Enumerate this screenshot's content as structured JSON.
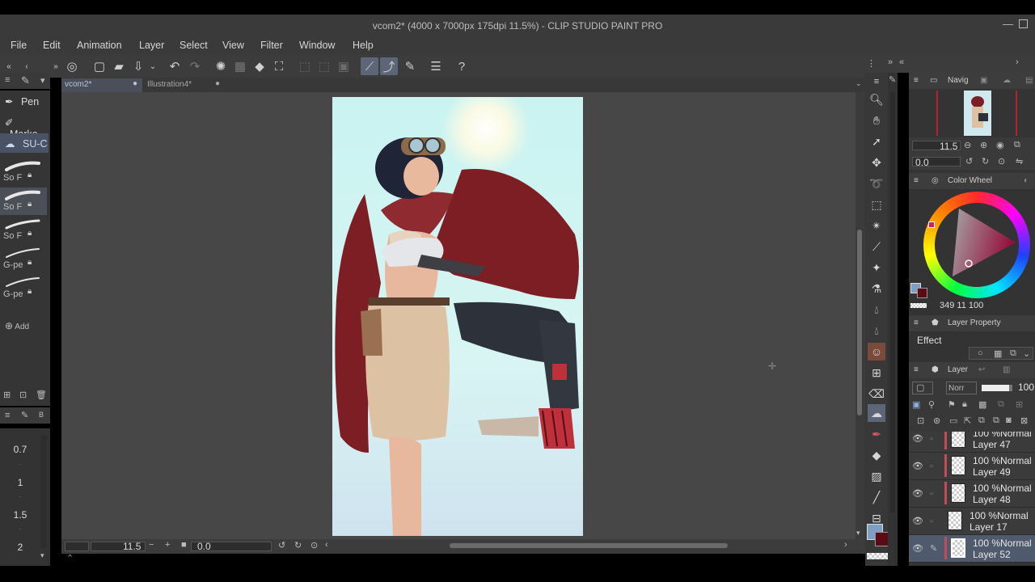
{
  "window": {
    "title": "vcom2* (4000 x 7000px 175dpi 11.5%)  - CLIP STUDIO PAINT PRO"
  },
  "menu": [
    "File",
    "Edit",
    "Animation",
    "Layer",
    "Select",
    "View",
    "Filter",
    "Window",
    "Help"
  ],
  "tabs": [
    {
      "label": "vcom2*",
      "active": true
    },
    {
      "label": "Illustration4*",
      "active": false
    }
  ],
  "subtools": [
    {
      "label": "Pen",
      "selected": false
    },
    {
      "label": "Marke",
      "selected": false
    },
    {
      "label": "SU-C",
      "selected": true
    }
  ],
  "brushes": [
    {
      "label": "So F",
      "selected": false
    },
    {
      "label": "So F",
      "selected": true
    },
    {
      "label": "So F",
      "selected": false
    },
    {
      "label": "G-pe",
      "selected": false
    },
    {
      "label": "G-pe",
      "selected": false
    }
  ],
  "add_label": "Add",
  "brush_size_header": "B",
  "brush_sizes": [
    "0.7",
    "1",
    "1.5",
    "2"
  ],
  "navigator": {
    "tab_label": "Navig",
    "zoom": "11.5",
    "rotation": "0.0"
  },
  "canvas_nav": {
    "zoom": "11.5",
    "rotation": "0.0"
  },
  "color_wheel": {
    "title": "Color Wheel",
    "values": "349 11 100",
    "main_color": "#7e9ec4",
    "sub_color": "#5a0c16"
  },
  "layer_property": {
    "title": "Layer Property",
    "effect_label": "Effect"
  },
  "layer_palette": {
    "title": "Layer",
    "blend_mode": "Norr",
    "opacity": "100",
    "layers": [
      {
        "mode": "100 %Normal",
        "name": "Layer 47",
        "selected": false,
        "red_tag": true
      },
      {
        "mode": "100 %Normal",
        "name": "Layer 49",
        "selected": false,
        "red_tag": true
      },
      {
        "mode": "100 %Normal",
        "name": "Layer 48",
        "selected": false,
        "red_tag": true
      },
      {
        "mode": "100 %Normal",
        "name": "Layer 17",
        "selected": false,
        "red_tag": false
      },
      {
        "mode": "100 %Normal",
        "name": "Layer 52",
        "selected": true,
        "red_tag": true
      }
    ]
  }
}
